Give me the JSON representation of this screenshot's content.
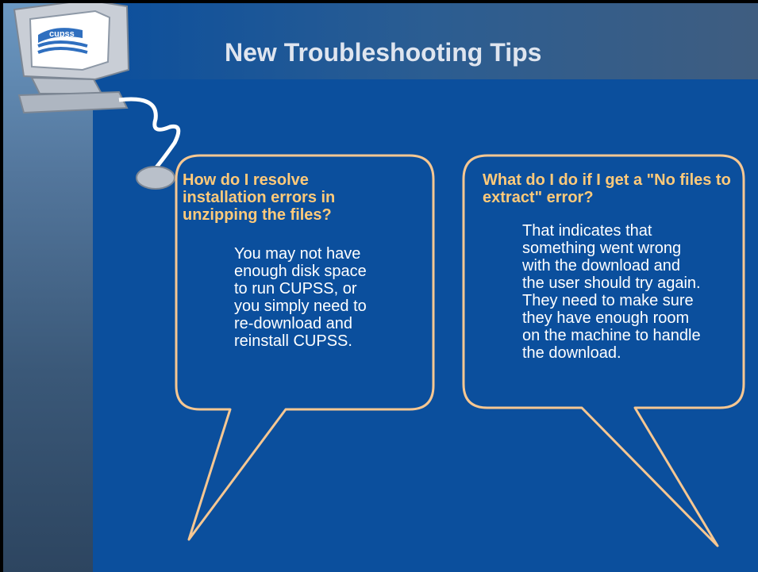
{
  "slide": {
    "title": "New Troubleshooting Tips",
    "logo_icon": "computer-mascot-icon",
    "bubbles": [
      {
        "question": "How do I resolve installation errors in unzipping the files?",
        "answer": "You may not have enough disk space to run CUPSS, or you simply need to re-download and reinstall CUPSS."
      },
      {
        "question": "What do I do if I get a \"No files to extract\" error?",
        "answer": "That indicates that something went wrong with the download and the user should try again. They need to make sure they have enough room on the machine to handle the download."
      }
    ]
  },
  "colors": {
    "background": "#0b4f9d",
    "question_text": "#ffca7a",
    "answer_text": "#ffffff",
    "bubble_outline": "#f6c792",
    "title_text": "#dfe5ef"
  }
}
